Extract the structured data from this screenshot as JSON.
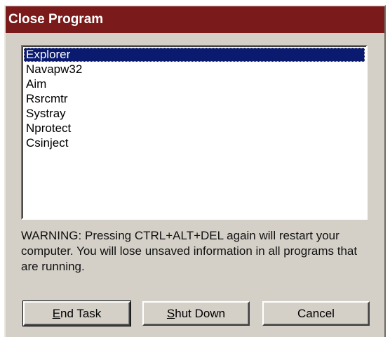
{
  "window": {
    "title": "Close Program"
  },
  "process_list": {
    "items": [
      "Explorer",
      "Navapw32",
      "Aim",
      "Rsrcmtr",
      "Systray",
      "Nprotect",
      "Csinject"
    ],
    "selected": "Explorer"
  },
  "warning_text": "WARNING: Pressing CTRL+ALT+DEL again will restart your computer. You will lose unsaved information in all programs that are running.",
  "buttons": {
    "end_task": {
      "mnemonic": "E",
      "rest": "nd Task"
    },
    "shut_down": {
      "mnemonic": "S",
      "rest": "hut Down"
    },
    "cancel": {
      "label": "Cancel"
    }
  },
  "colors": {
    "titlebar": "#7b1a1a",
    "selection": "#0a1a6e",
    "face": "#d4d0c8"
  }
}
